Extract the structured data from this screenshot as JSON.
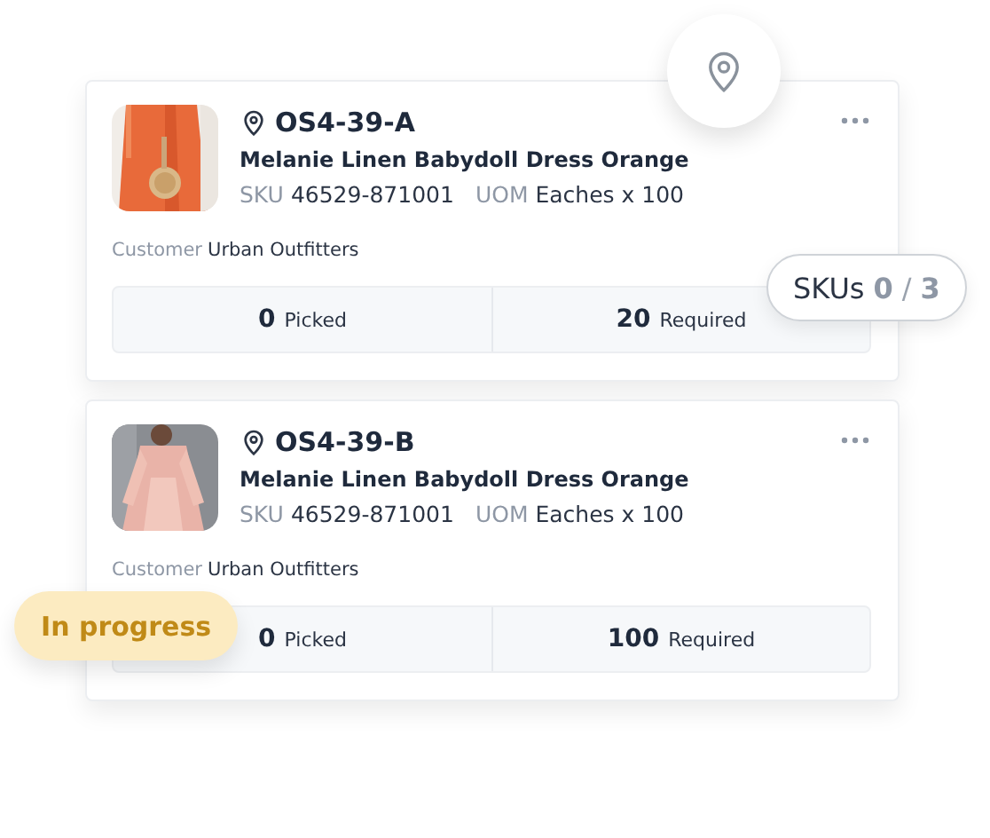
{
  "cards": [
    {
      "location": "OS4-39-A",
      "product": "Melanie Linen Babydoll Dress Orange",
      "sku_label": "SKU",
      "sku": "46529-871001",
      "uom_label": "UOM",
      "uom": "Eaches x 100",
      "customer_label": "Customer",
      "customer": "Urban Outfitters",
      "picked": "0",
      "picked_label": "Picked",
      "required": "20",
      "required_label": "Required"
    },
    {
      "location": "OS4-39-B",
      "product": "Melanie Linen Babydoll Dress Orange",
      "sku_label": "SKU",
      "sku": "46529-871001",
      "uom_label": "UOM",
      "uom": "Eaches x 100",
      "customer_label": "Customer",
      "customer": "Urban Outfitters",
      "picked": "0",
      "picked_label": "Picked",
      "required": "100",
      "required_label": "Required"
    }
  ],
  "skus_pill": {
    "label": "SKUs",
    "done": "0",
    "separator": "/",
    "total": "3"
  },
  "status_badge": {
    "label": "In progress"
  }
}
